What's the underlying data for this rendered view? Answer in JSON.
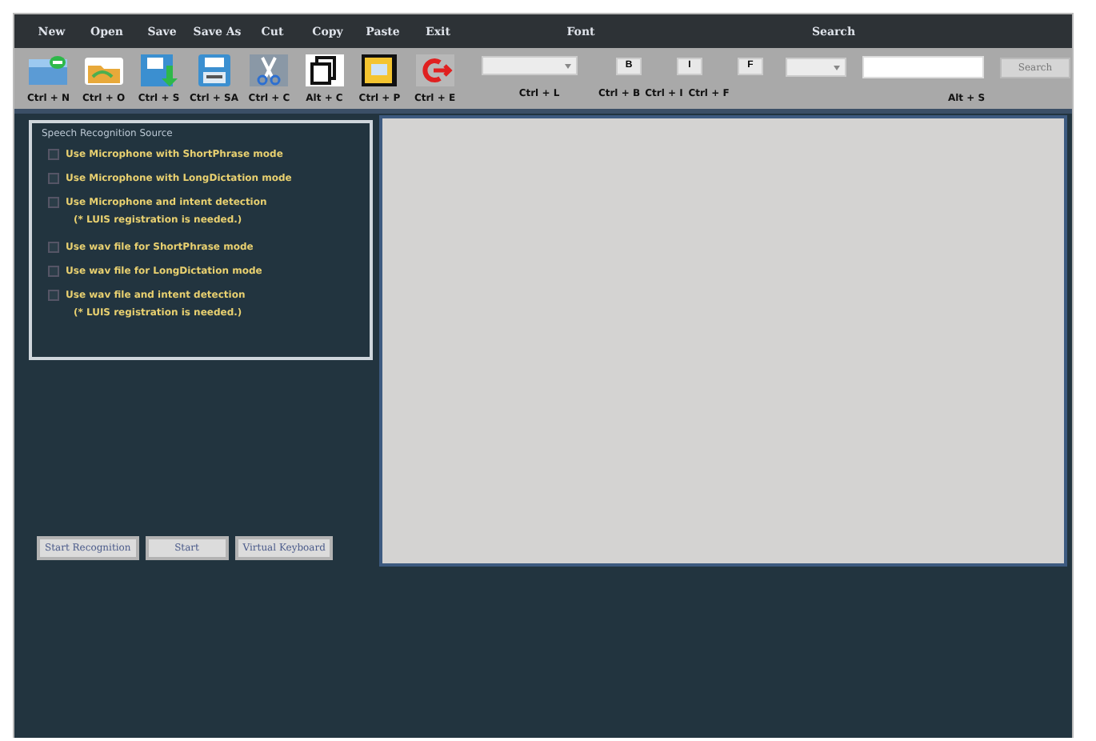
{
  "menu": [
    {
      "label": "New"
    },
    {
      "label": "Open"
    },
    {
      "label": "Save"
    },
    {
      "label": "Save As"
    },
    {
      "label": "Cut"
    },
    {
      "label": "Copy"
    },
    {
      "label": "Paste"
    },
    {
      "label": "Exit"
    }
  ],
  "toolbar": [
    {
      "kind": "new",
      "shortcut": "Ctrl + N"
    },
    {
      "kind": "open",
      "shortcut": "Ctrl + O"
    },
    {
      "kind": "save",
      "shortcut": "Ctrl + S"
    },
    {
      "kind": "saveas",
      "shortcut": "Ctrl + SA"
    },
    {
      "kind": "cut",
      "shortcut": "Ctrl + C"
    },
    {
      "kind": "copy",
      "shortcut": "Alt + C"
    },
    {
      "kind": "paste",
      "shortcut": "Ctrl + P"
    },
    {
      "kind": "exit",
      "shortcut": "Ctrl + E"
    }
  ],
  "font": {
    "title": "Font",
    "font_shortcut": "Ctrl + L",
    "styles": [
      {
        "label": "B",
        "shortcut": "Ctrl + B"
      },
      {
        "label": "I",
        "shortcut": "Ctrl + I"
      },
      {
        "label": "F",
        "shortcut": "Ctrl + F"
      }
    ]
  },
  "search": {
    "title": "Search",
    "button": "Search",
    "shortcut": "Alt + S"
  },
  "speech_source": {
    "title": "Speech Recognition Source",
    "options": [
      {
        "label": "Use Microphone with ShortPhrase mode",
        "checked": false
      },
      {
        "label": "Use Microphone with LongDictation mode",
        "checked": false
      },
      {
        "label": "Use Microphone and intent detection",
        "checked": false,
        "note": "(* LUIS registration is needed.)"
      },
      {
        "label": "Use wav file for ShortPhrase mode",
        "checked": false
      },
      {
        "label": "Use wav file for LongDictation mode",
        "checked": false
      },
      {
        "label": "Use wav file and intent detection",
        "checked": false,
        "note": "(* LUIS registration is needed.)"
      }
    ]
  },
  "buttons": [
    "Start Recognition",
    "Start",
    "Virtual Keyboard"
  ]
}
